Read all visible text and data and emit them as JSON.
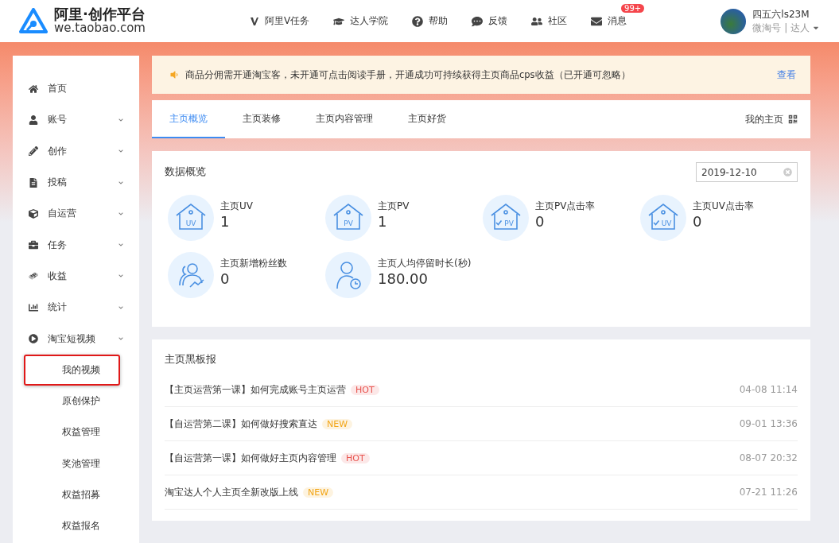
{
  "header": {
    "logo_title": "阿里·创作平台",
    "logo_domain": "we.taobao.com",
    "nav": [
      {
        "kind": "v",
        "label": "阿里V任务"
      },
      {
        "kind": "cap",
        "label": "达人学院"
      },
      {
        "kind": "help",
        "label": "帮助"
      },
      {
        "kind": "comment",
        "label": "反馈"
      },
      {
        "kind": "users",
        "label": "社区"
      },
      {
        "kind": "mail",
        "label": "消息",
        "badge": "99+"
      }
    ],
    "user": {
      "name": "四五六ls23M",
      "role": "微淘号 | 达人"
    }
  },
  "sidebar": {
    "items": [
      {
        "kind": "home",
        "label": "首页",
        "expandable": false
      },
      {
        "kind": "user",
        "label": "账号",
        "expandable": true
      },
      {
        "kind": "pencil",
        "label": "创作",
        "expandable": true
      },
      {
        "kind": "file",
        "label": "投稿",
        "expandable": true
      },
      {
        "kind": "cube",
        "label": "自运营",
        "expandable": true
      },
      {
        "kind": "briefcase",
        "label": "任务",
        "expandable": true
      },
      {
        "kind": "money",
        "label": "收益",
        "expandable": true
      },
      {
        "kind": "chart",
        "label": "统计",
        "expandable": true
      },
      {
        "kind": "video",
        "label": "淘宝短视频",
        "expandable": true,
        "children": [
          {
            "label": "我的视频",
            "highlighted": true
          },
          {
            "label": "原创保护",
            "highlighted": false
          },
          {
            "label": "权益管理",
            "highlighted": false
          },
          {
            "label": "奖池管理",
            "highlighted": false
          },
          {
            "label": "权益招募",
            "highlighted": false
          },
          {
            "label": "权益报名",
            "highlighted": false
          }
        ]
      }
    ]
  },
  "notice": {
    "text": "商品分佣需开通淘宝客，未开通可点击阅读手册，开通成功可持续获得主页商品cps收益（已开通可忽略）",
    "link": "查看"
  },
  "tabs": [
    {
      "label": "主页概览",
      "selected": true
    },
    {
      "label": "主页装修",
      "selected": false
    },
    {
      "label": "主页内容管理",
      "selected": false
    },
    {
      "label": "主页好货",
      "selected": false
    }
  ],
  "my_homepage": "我的主页",
  "overview": {
    "title": "数据概览",
    "date": "2019-12-10",
    "stats": [
      {
        "kind": "house",
        "icon_text": "UV",
        "label": "主页UV",
        "value": "1"
      },
      {
        "kind": "house",
        "icon_text": "PV",
        "label": "主页PV",
        "value": "1"
      },
      {
        "kind": "house-check",
        "icon_text": "PV",
        "label": "主页PV点击率",
        "value": "0"
      },
      {
        "kind": "house-check",
        "icon_text": "UV",
        "label": "主页UV点击率",
        "value": "0"
      },
      {
        "kind": "fans",
        "label": "主页新增粉丝数",
        "value": "0"
      },
      {
        "kind": "person-clock",
        "label": "主页人均停留时长(秒)",
        "value": "180.00"
      }
    ]
  },
  "board": {
    "title": "主页黑板报",
    "rows": [
      {
        "title": "【主页运营第一课】如何完成账号主页运营",
        "tag": "HOT",
        "color": "#e8544f",
        "time": "04-08 11:14"
      },
      {
        "title": "【自运营第二课】如何做好搜索直达",
        "tag": "NEW",
        "color": "#f2a516",
        "time": "09-01 13:36"
      },
      {
        "title": "【自运营第一课】如何做好主页内容管理",
        "tag": "HOT",
        "color": "#e8544f",
        "time": "08-07 20:32"
      },
      {
        "title": "淘宝达人个人主页全新改版上线",
        "tag": "NEW",
        "color": "#f2a516",
        "time": "07-21 11:26"
      }
    ]
  }
}
